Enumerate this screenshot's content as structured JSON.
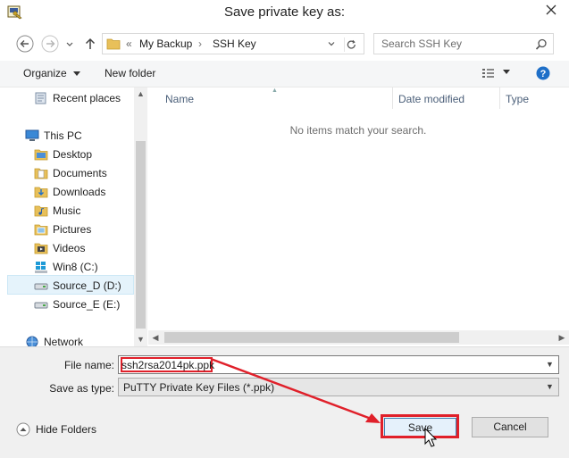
{
  "window": {
    "title": "Save private key as:"
  },
  "address": {
    "crumb_sep": "«",
    "segments": [
      "My Backup",
      "SSH Key"
    ]
  },
  "search": {
    "placeholder": "Search SSH Key"
  },
  "toolbar": {
    "organize_label": "Organize",
    "new_folder_label": "New folder"
  },
  "nav": {
    "items": [
      {
        "label": "Recent places",
        "icon": "recent-places-icon"
      },
      {
        "label": "This PC",
        "icon": "computer-icon"
      },
      {
        "label": "Desktop",
        "icon": "folder-icon"
      },
      {
        "label": "Documents",
        "icon": "folder-icon"
      },
      {
        "label": "Downloads",
        "icon": "folder-icon"
      },
      {
        "label": "Music",
        "icon": "folder-icon"
      },
      {
        "label": "Pictures",
        "icon": "folder-icon"
      },
      {
        "label": "Videos",
        "icon": "folder-icon"
      },
      {
        "label": "Win8 (C:)",
        "icon": "windows-drive-icon"
      },
      {
        "label": "Source_D (D:)",
        "icon": "drive-icon",
        "selected": true
      },
      {
        "label": "Source_E (E:)",
        "icon": "drive-icon"
      },
      {
        "label": "Network",
        "icon": "network-icon"
      }
    ]
  },
  "files": {
    "columns": [
      "Name",
      "Date modified",
      "Type"
    ],
    "empty_message": "No items match your search."
  },
  "form": {
    "file_name_label": "File name:",
    "file_name_value": "ssh2rsa2014pk.ppk",
    "save_as_type_label": "Save as type:",
    "save_as_type_value": "PuTTY Private Key Files (*.ppk)"
  },
  "footer": {
    "hide_folders_label": "Hide Folders",
    "save_label": "Save",
    "cancel_label": "Cancel"
  },
  "colors": {
    "annotation": "#e0202a",
    "accent": "#3c7fb1",
    "help": "#1e6fc8"
  }
}
